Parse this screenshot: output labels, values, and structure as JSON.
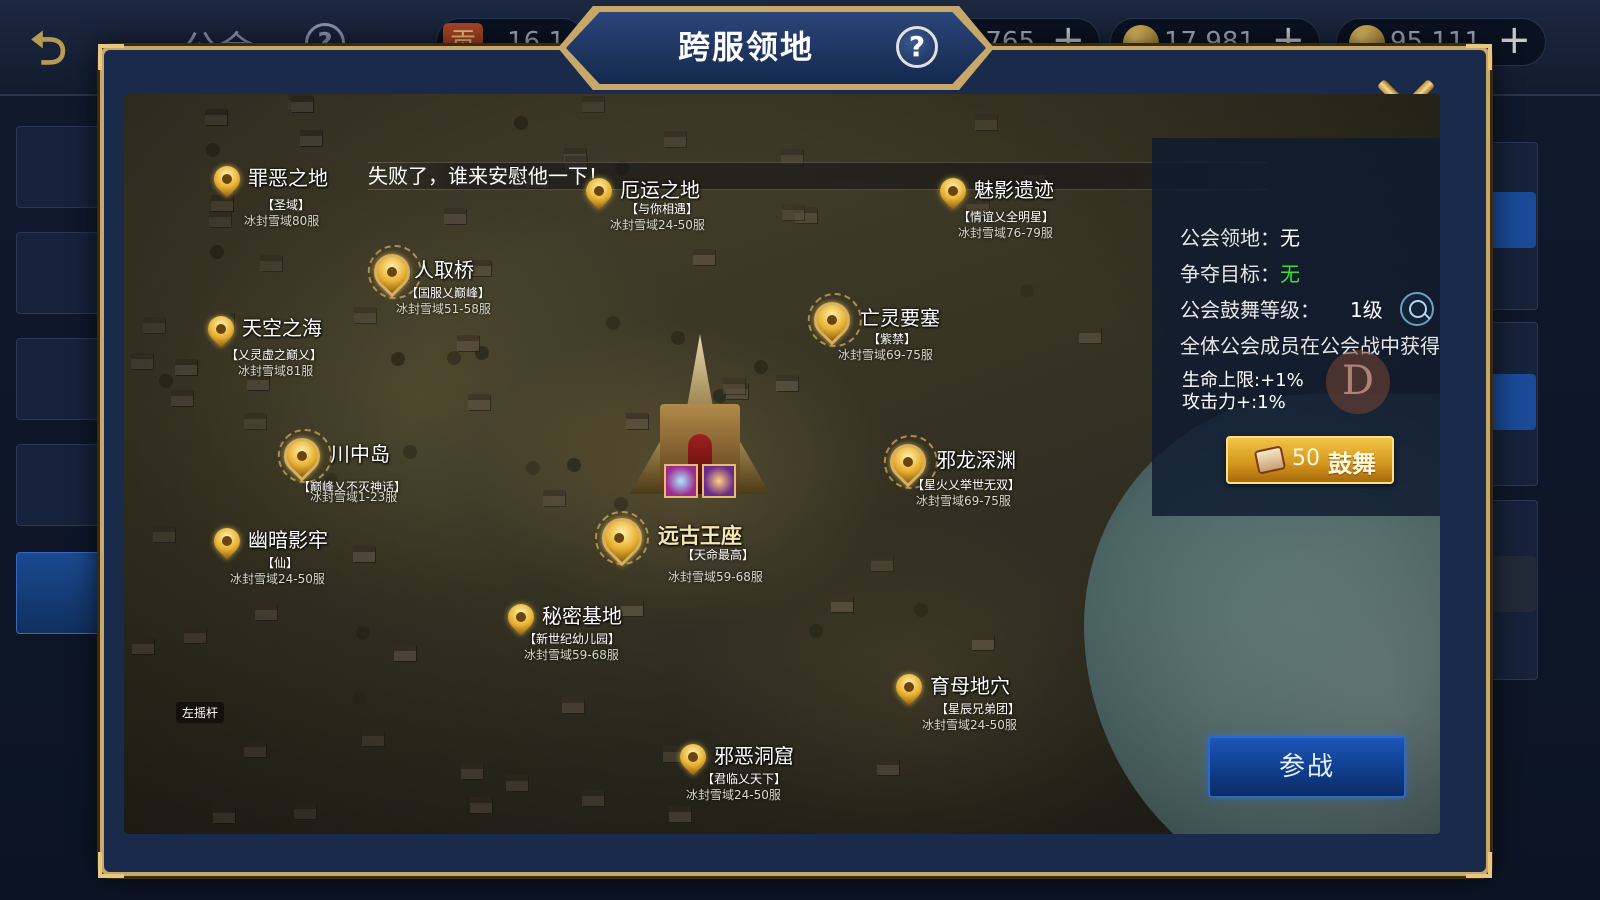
{
  "hud": {
    "back_icon": "back-arrow-icon",
    "guild_title": "公会",
    "help_symbol": "?",
    "resources": [
      {
        "icon": "contribution-badge-icon",
        "badge": "贡",
        "value": "16.1",
        "plus": "+"
      },
      {
        "icon": "gem-icon",
        "value": "765",
        "plus": "+"
      },
      {
        "icon": "gold-coin-icon",
        "value": "17,981",
        "plus": "+"
      },
      {
        "icon": "gold-coin-icon",
        "value": "95,111",
        "plus": "+"
      }
    ]
  },
  "modal": {
    "title": "跨服领地",
    "help_symbol": "?",
    "close_icon": "close-x-icon"
  },
  "announcement": "失败了，谁来安慰他一下！",
  "territories": [
    {
      "name": "罪恶之地",
      "guild": "【圣域】",
      "server": "冰封雪域80服"
    },
    {
      "name": "厄运之地",
      "guild": "【与你相遇】",
      "server": "冰封雪域24-50服"
    },
    {
      "name": "魅影遗迹",
      "guild": "【情谊乂全明星】",
      "server": "冰封雪域76-79服"
    },
    {
      "name": "人取桥",
      "guild": "【国服乂巅峰】",
      "server": "冰封雪域51-58服"
    },
    {
      "name": "天空之海",
      "guild": "【乂灵虚之巅乂】",
      "server": "冰封雪域81服"
    },
    {
      "name": "亡灵要塞",
      "guild": "【紫禁】",
      "server": "冰封雪域69-75服"
    },
    {
      "name": "川中岛",
      "guild": "【巅峰乂不灭神话】",
      "server": "冰封雪域1-23服"
    },
    {
      "name": "邪龙深渊",
      "guild": "【星火乂举世无双】",
      "server": "冰封雪域69-75服"
    },
    {
      "name": "幽暗影牢",
      "guild": "【仙】",
      "server": "冰封雪域24-50服"
    },
    {
      "name": "远古王座",
      "guild": "【天命最高】",
      "server": "冰封雪域59-68服"
    },
    {
      "name": "秘密基地",
      "guild": "【新世纪幼儿园】",
      "server": "冰封雪域59-68服"
    },
    {
      "name": "育母地穴",
      "guild": "【星辰兄弟团】",
      "server": "冰封雪域24-50服"
    },
    {
      "name": "邪恶洞窟",
      "guild": "【君临乂天下】",
      "server": "冰封雪域24-50服"
    }
  ],
  "joystick_label": "左摇杆",
  "info": {
    "territory_label": "公会领地：",
    "territory_value": "无",
    "target_label": "争夺目标：",
    "target_value": "无",
    "drum_level_label": "公会鼓舞等级：",
    "drum_level_value": "1级",
    "members_note": "全体公会成员在公会战中获得",
    "buff_hp": "生命上限:+1%",
    "buff_atk": "攻击力+:1%",
    "watermark": "D",
    "drum_cost": "50",
    "drum_button": "鼓舞",
    "target_color": "#38e038"
  },
  "join_button": "参战"
}
